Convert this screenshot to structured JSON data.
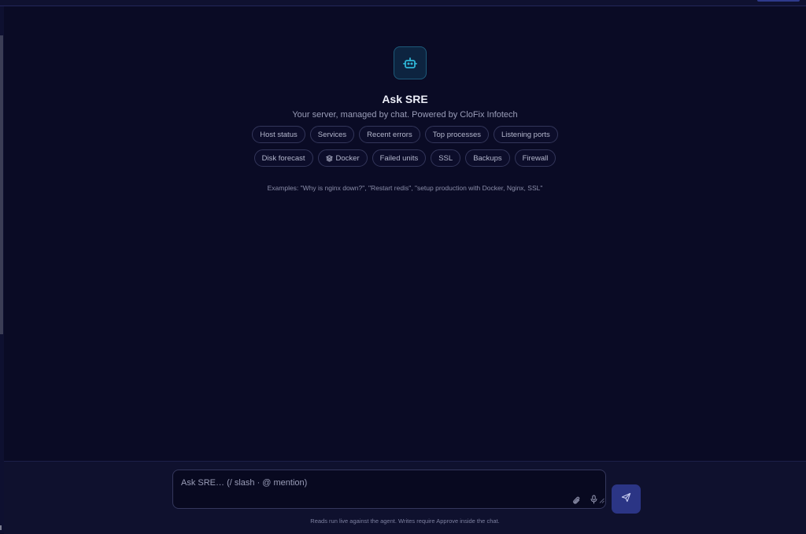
{
  "hero": {
    "icon": "robot-icon",
    "title": "Ask SRE",
    "subtitle": "Your server, managed by chat. Powered by CloFix Infotech"
  },
  "chips_row1": [
    "Host status",
    "Services",
    "Recent errors",
    "Top processes",
    "Listening ports"
  ],
  "chips_row2": [
    "Disk forecast",
    "Docker",
    "Failed units",
    "SSL",
    "Backups",
    "Firewall"
  ],
  "examples": "Examples: \"Why is nginx down?\", \"Restart redis\", \"setup production with Docker, Nginx, SSL\"",
  "composer": {
    "placeholder": "Ask SRE… (/ slash · @ mention)",
    "attach_icon": "paperclip-icon",
    "mic_icon": "microphone-icon",
    "send_icon": "send-icon",
    "footnote": "Reads run live against the agent. Writes require Approve inside the chat."
  },
  "colors": {
    "background": "#0a0b25",
    "accent_cyan": "#2fb6d6",
    "send_button": "#2b3585"
  }
}
